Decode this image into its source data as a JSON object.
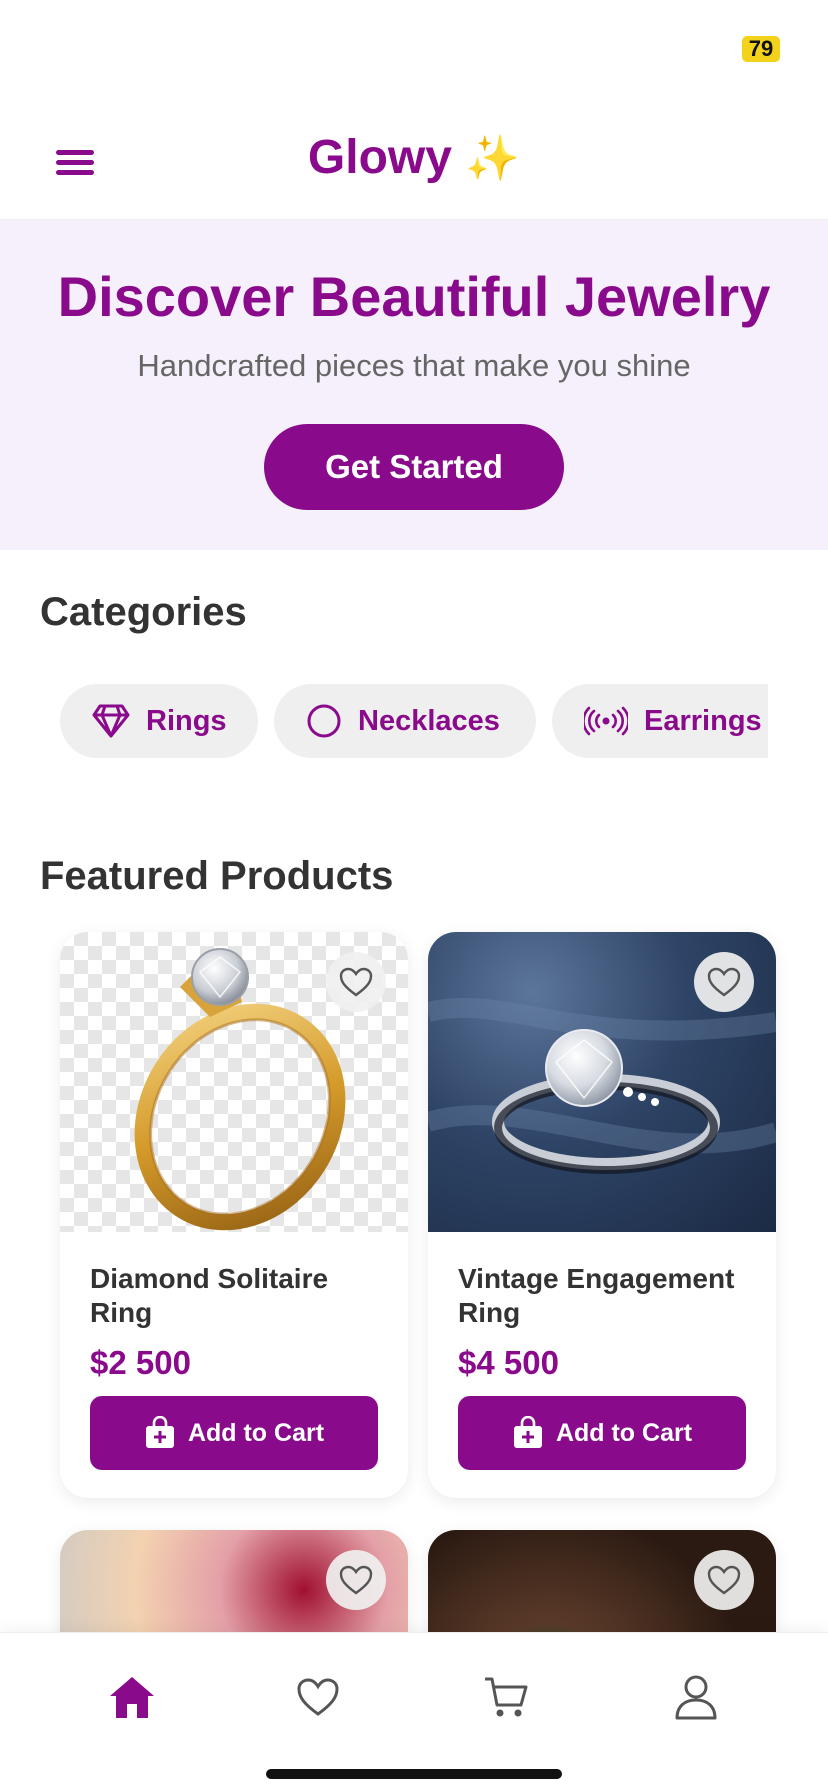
{
  "status_bar": {
    "battery": "79"
  },
  "header": {
    "title": "Glowy",
    "sparkle": "✨",
    "menu_icon": "hamburger-menu-icon"
  },
  "hero": {
    "title": "Discover Beautiful Jewelry",
    "subtitle": "Handcrafted pieces that make you shine",
    "cta_label": "Get Started"
  },
  "categories": {
    "title": "Categories",
    "items": [
      {
        "label": "Rings",
        "icon": "diamond-icon"
      },
      {
        "label": "Necklaces",
        "icon": "circle-icon"
      },
      {
        "label": "Earrings",
        "icon": "radio-waves-icon"
      }
    ]
  },
  "featured": {
    "title": "Featured Products",
    "products": [
      {
        "name": "Diamond Solitaire Ring",
        "price": "$2 500",
        "cta": "Add to Cart"
      },
      {
        "name": "Vintage Engagement Ring",
        "price": "$4 500",
        "cta": "Add to Cart"
      }
    ]
  },
  "bottom_nav": {
    "items": [
      {
        "icon": "home-icon",
        "active": true
      },
      {
        "icon": "heart-icon",
        "active": false
      },
      {
        "icon": "cart-icon",
        "active": false
      },
      {
        "icon": "profile-icon",
        "active": false
      }
    ]
  },
  "colors": {
    "accent": "#8a0a8c",
    "hero_bg": "#f5f0fb",
    "chip_bg": "#efefef",
    "battery": "#f2d21b"
  }
}
